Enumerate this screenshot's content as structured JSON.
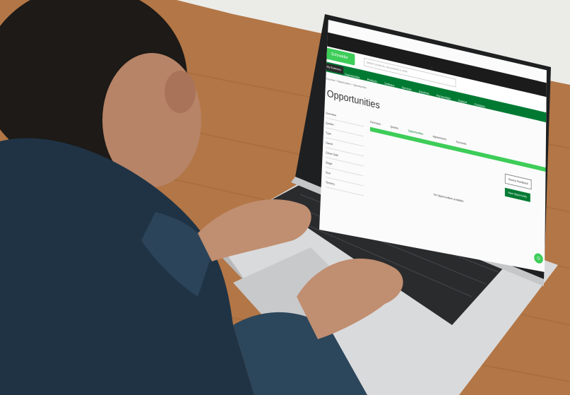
{
  "screen": {
    "top_bar": "",
    "logo": "Schneider Electric",
    "search_placeholder": "Search products, documents & more",
    "brand_tag": "My Business",
    "nav": [
      "Opportunities",
      "Products",
      "Software",
      "Services",
      "Solutions",
      "Partnerships",
      "Support",
      "Company"
    ],
    "breadcrumb": "Overview > Opportunities > Opportunities",
    "page_title": "Opportunities",
    "sidebar": [
      "Overview",
      "Quotes",
      "Type",
      "Owner",
      "Close Date",
      "Stage",
      "Size",
      "Territory"
    ],
    "tabs": [
      "Overview",
      "Quotes",
      "Opportunities",
      "Agreements",
      "Accounts"
    ],
    "actions": {
      "outline": "Source Feedback",
      "primary": "New Opportunity"
    },
    "empty_state": "No Opportunities available"
  },
  "colors": {
    "brand_green": "#3dcd58",
    "dark_green": "#007a33",
    "table_wood": "#b57a48"
  }
}
